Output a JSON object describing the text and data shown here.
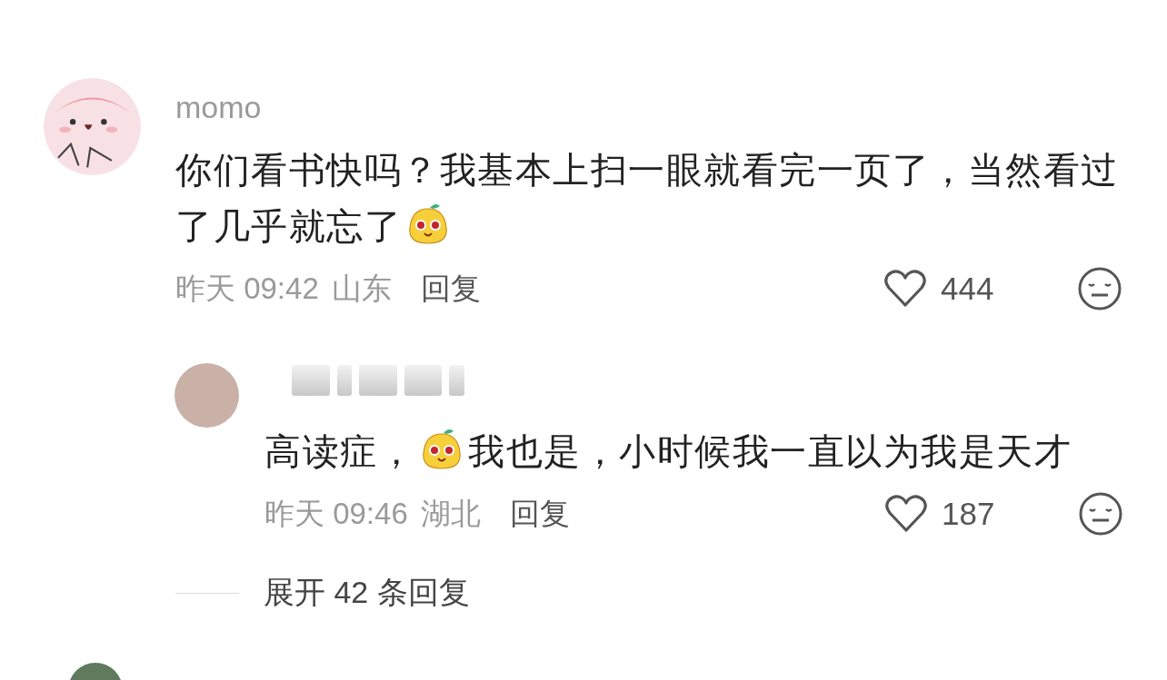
{
  "comment": {
    "username": "momo",
    "content": [
      {
        "kind": "text",
        "text": "你们看书快吗？我基本上扫一眼就看完一页了，当然看过"
      },
      {
        "kind": "text",
        "text": "了几乎就忘了"
      },
      {
        "kind": "sticker"
      }
    ],
    "time": "昨天 09:42",
    "location": "山东",
    "reply_label": "回复",
    "likes": "444"
  },
  "reply": {
    "content": [
      {
        "kind": "text",
        "text": "高读症，"
      },
      {
        "kind": "sticker"
      },
      {
        "kind": "text",
        "text": "我也是，小时候我一直以为我是天才"
      }
    ],
    "time": "昨天 09:46",
    "location": "湖北",
    "reply_label": "回复",
    "likes": "187"
  },
  "expand_label": "展开 42 条回复"
}
